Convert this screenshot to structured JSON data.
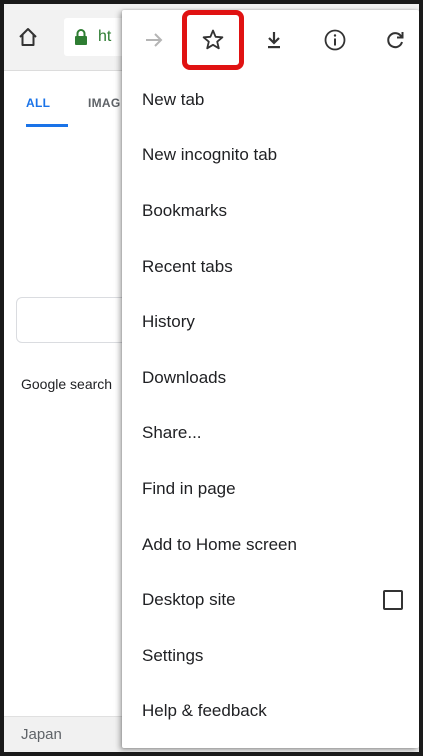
{
  "toolbar": {
    "home_icon": "home-icon",
    "lock_icon": "lock-icon",
    "url_partial": "ht"
  },
  "page": {
    "tabs": [
      {
        "label": "ALL",
        "active": true
      },
      {
        "label": "IMAG",
        "active": false
      }
    ],
    "search_label": "Google search",
    "footer_country": "Japan"
  },
  "menu": {
    "actions": [
      {
        "name": "forward-icon"
      },
      {
        "name": "bookmark-star-icon",
        "highlighted": true
      },
      {
        "name": "download-icon"
      },
      {
        "name": "info-icon"
      },
      {
        "name": "reload-icon"
      }
    ],
    "items": [
      {
        "label": "New tab"
      },
      {
        "label": "New incognito tab"
      },
      {
        "label": "Bookmarks"
      },
      {
        "label": "Recent tabs"
      },
      {
        "label": "History"
      },
      {
        "label": "Downloads"
      },
      {
        "label": "Share..."
      },
      {
        "label": "Find in page"
      },
      {
        "label": "Add to Home screen"
      },
      {
        "label": "Desktop site",
        "checked": false
      },
      {
        "label": "Settings"
      },
      {
        "label": "Help & feedback"
      }
    ]
  },
  "colors": {
    "accent": "#1a73e8",
    "highlight": "#e01212",
    "secure_green": "#2e7d32"
  }
}
